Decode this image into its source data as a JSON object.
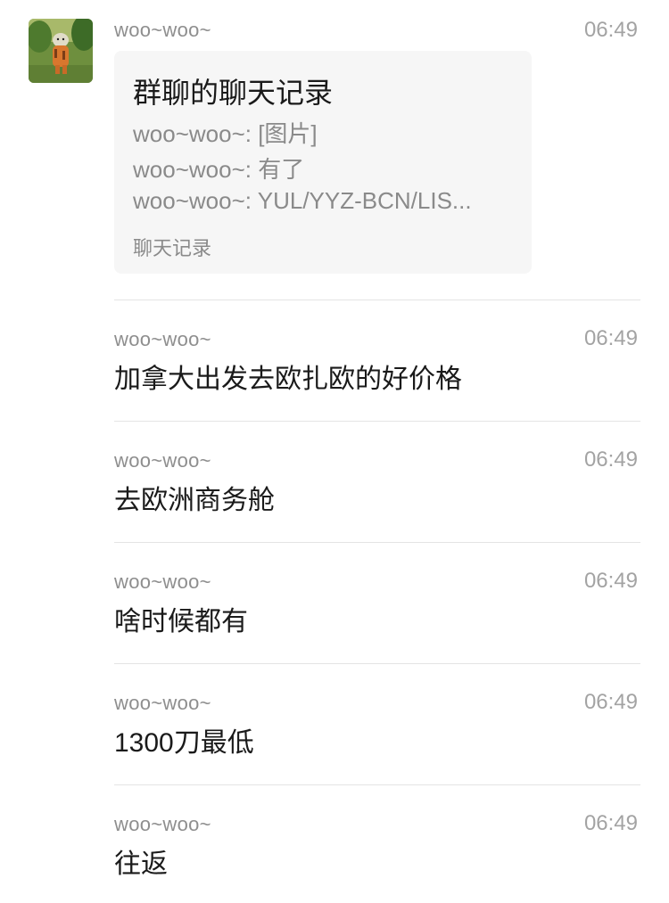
{
  "first_message": {
    "sender": "woo~woo~",
    "time": "06:49",
    "avatar_icon": "tigger-cartoon-avatar-icon",
    "card": {
      "title": "群聊的聊天记录",
      "lines": [
        "woo~woo~: [图片]",
        "woo~woo~: 有了",
        "woo~woo~: YUL/YYZ-BCN/LIS..."
      ],
      "footer": "聊天记录"
    }
  },
  "messages": [
    {
      "sender": "woo~woo~",
      "time": "06:49",
      "text": "加拿大出发去欧扎欧的好价格"
    },
    {
      "sender": "woo~woo~",
      "time": "06:49",
      "text": "去欧洲商务舱"
    },
    {
      "sender": "woo~woo~",
      "time": "06:49",
      "text": "啥时候都有"
    },
    {
      "sender": "woo~woo~",
      "time": "06:49",
      "text": "1300刀最低"
    },
    {
      "sender": "woo~woo~",
      "time": "06:49",
      "text": "往返"
    }
  ],
  "colors": {
    "background": "#ffffff",
    "card_background": "#f6f6f6",
    "sender_text": "#8e8e8e",
    "time_text": "#a3a3a3",
    "body_text": "#1a1a1a",
    "divider": "#e4e4e4"
  }
}
